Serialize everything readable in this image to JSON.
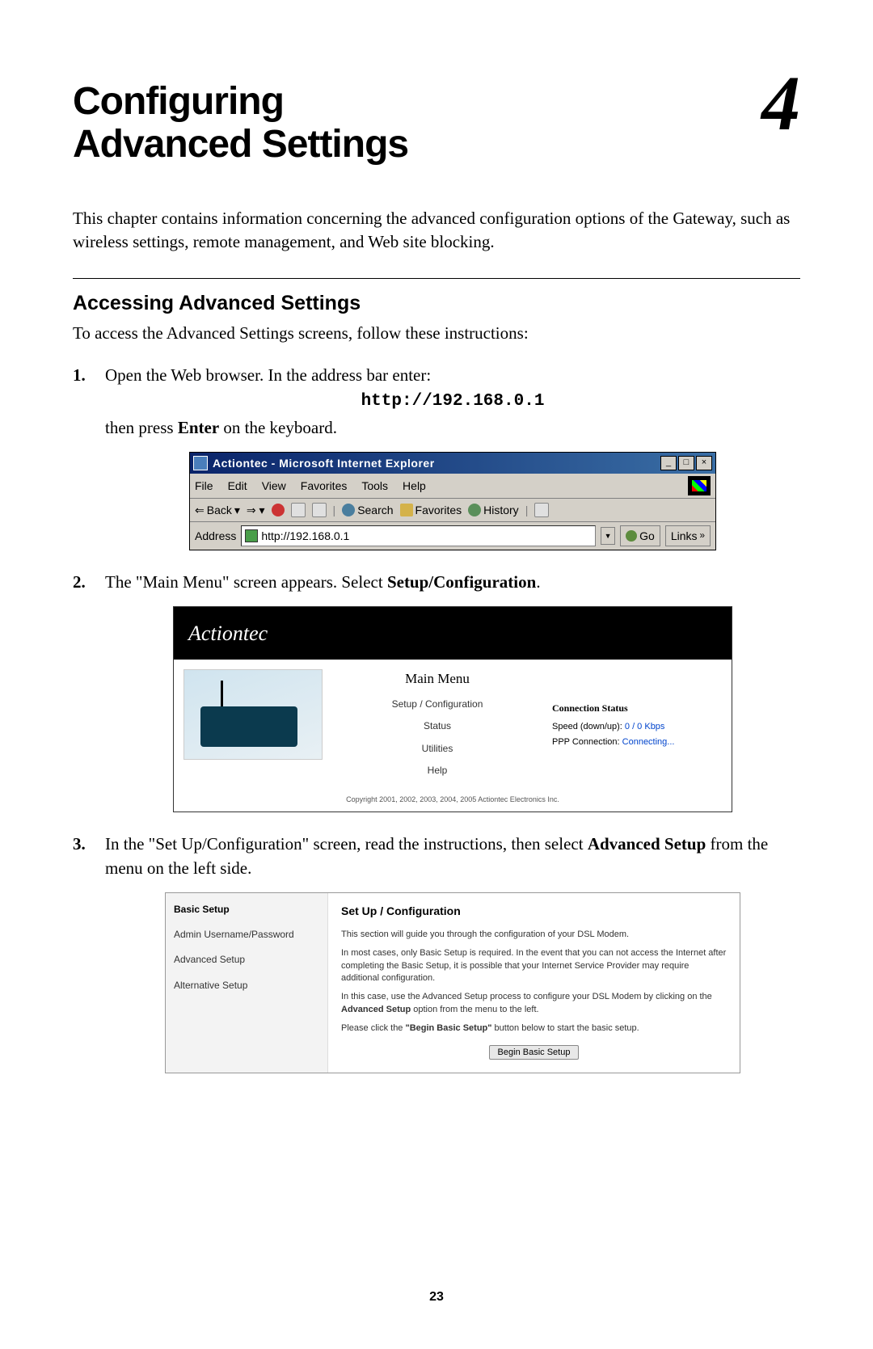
{
  "chapter": {
    "title_line1": "Configuring",
    "title_line2": "Advanced Settings",
    "number": "4"
  },
  "intro": "This chapter contains information concerning the advanced configuration options of the Gateway, such as wireless settings, remote management, and Web site blocking.",
  "section": {
    "heading": "Accessing Advanced Settings",
    "lead": "To access the Advanced Settings screens, follow these instructions:"
  },
  "step1": {
    "text_a": "Open the Web browser. In the address bar enter:",
    "url": "http://192.168.0.1",
    "text_b1": "then press ",
    "text_b_bold": "Enter",
    "text_b2": " on the keyboard."
  },
  "ie": {
    "title": "Actiontec - Microsoft Internet Explorer",
    "menu": {
      "file": "File",
      "edit": "Edit",
      "view": "View",
      "favorites": "Favorites",
      "tools": "Tools",
      "help": "Help"
    },
    "toolbar": {
      "back": "Back",
      "search": "Search",
      "favorites": "Favorites",
      "history": "History"
    },
    "address_label": "Address",
    "address_value": "http://192.168.0.1",
    "go": "Go",
    "links": "Links"
  },
  "step2": {
    "text_a": "The \"Main Menu\" screen appears. Select ",
    "bold": "Setup/Configuration",
    "text_b": "."
  },
  "actiontec": {
    "logo": "Actiontec",
    "menu_title": "Main Menu",
    "links": {
      "setup": "Setup / Configuration",
      "status": "Status",
      "utilities": "Utilities",
      "help": "Help"
    },
    "status_title": "Connection Status",
    "speed_label": "Speed (down/up): ",
    "speed_value": "0 / 0 Kbps",
    "ppp_label": "PPP Connection:   ",
    "ppp_value": "Connecting...",
    "copyright": "Copyright 2001, 2002, 2003, 2004, 2005 Actiontec Electronics Inc."
  },
  "step3": {
    "text_a": "In the \"Set Up/Configuration\" screen, read the instructions, then select ",
    "bold": "Advanced Setup",
    "text_b": " from the menu on the left side."
  },
  "setup": {
    "sidebar": {
      "title": "Basic Setup",
      "admin": "Admin Username/Password",
      "advanced": "Advanced Setup",
      "alternative": "Alternative Setup"
    },
    "main": {
      "title": "Set Up / Configuration",
      "p1": "This section will guide you through the configuration of your DSL Modem.",
      "p2": "In most cases, only Basic Setup is required. In the event that you can not access the Internet after completing the Basic Setup, it is possible that your Internet Service Provider may require additional configuration.",
      "p3a": "In this case, use the Advanced Setup process to configure your DSL Modem by clicking on the ",
      "p3bold": "Advanced Setup",
      "p3b": " option from the menu to the left.",
      "p4a": "Please click the ",
      "p4bold": "\"Begin Basic Setup\"",
      "p4b": " button below to start the basic setup.",
      "button": "Begin Basic Setup"
    }
  },
  "page_number": "23"
}
